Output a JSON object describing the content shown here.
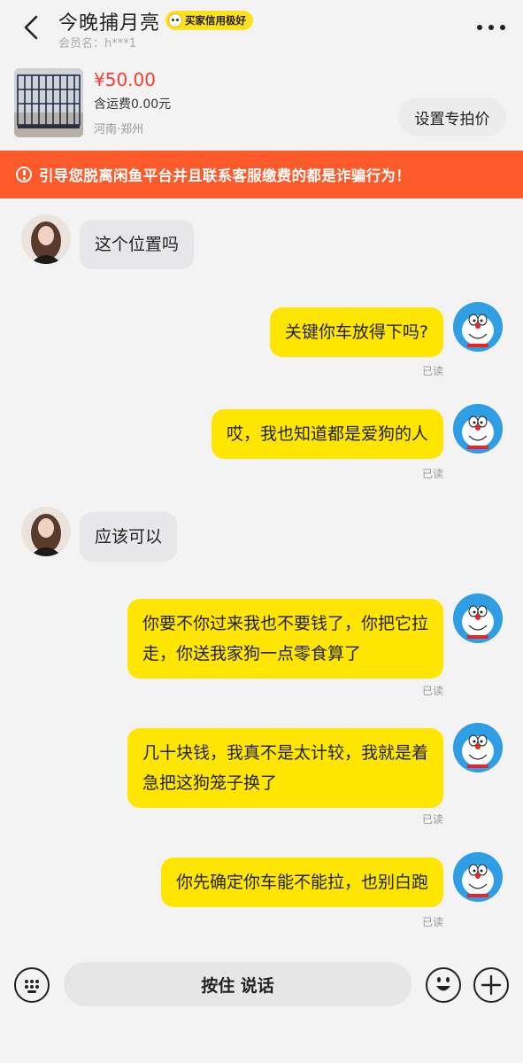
{
  "header": {
    "title": "今晚捕月亮",
    "badge": "买家信用极好",
    "member_name": "会员名：h***1"
  },
  "product": {
    "price": "¥50.00",
    "shipping": "含运费0.00元",
    "location": "河南·郑州",
    "special_price_button": "设置专拍价"
  },
  "warning": {
    "text": "引导您脱离闲鱼平台并且联系客服缴费的都是诈骗行为！",
    "color": "#fc5a2a"
  },
  "messages": [
    {
      "side": "in",
      "text": "这个位置吗"
    },
    {
      "side": "out",
      "text": "关键你车放得下吗?",
      "status": "已读"
    },
    {
      "side": "out",
      "text": "哎，我也知道都是爱狗的人",
      "status": "已读"
    },
    {
      "side": "in",
      "text": "应该可以"
    },
    {
      "side": "out",
      "line1": "你要不你过来我也不要钱了，你把它拉",
      "line2": "走，你送我家狗一点零食算了",
      "status": "已读"
    },
    {
      "side": "out",
      "line1": "几十块钱，我真不是太计较，我就是着",
      "line2": "急把这狗笼子换了",
      "status": "已读"
    },
    {
      "side": "out",
      "text": "你先确定你车能不能拉，也别白跑",
      "status": "已读"
    }
  ],
  "input_bar": {
    "voice_button": "按住 说话"
  },
  "colors": {
    "outgoing_bubble": "#ffe600",
    "incoming_bubble": "#e7e7e9",
    "price": "#ff3b30",
    "badge": "#ffe11b"
  }
}
